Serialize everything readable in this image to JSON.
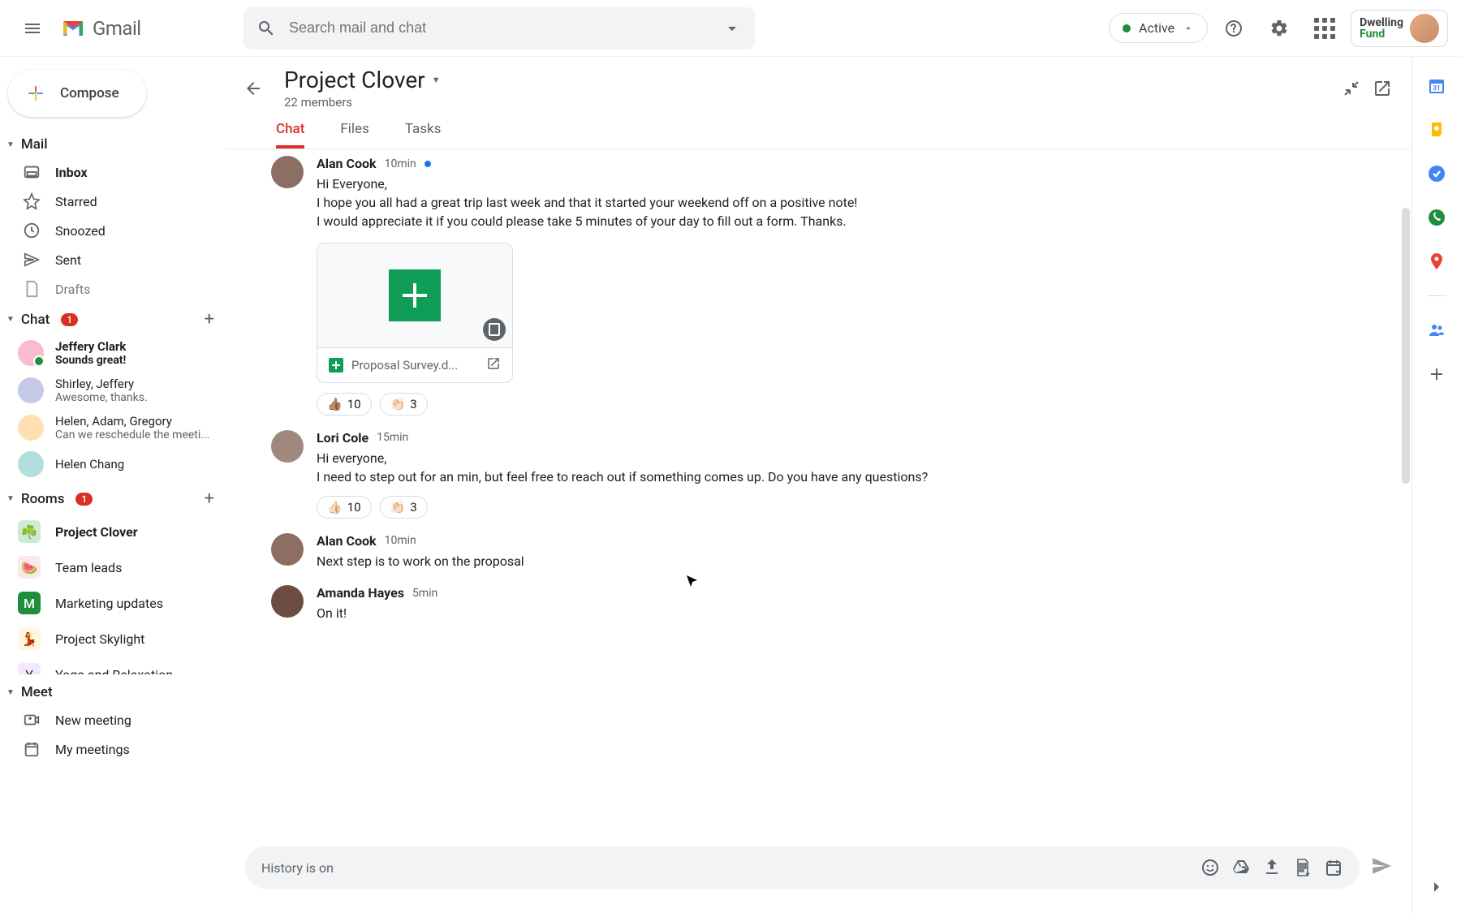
{
  "header": {
    "app_name": "Gmail",
    "search_placeholder": "Search mail and chat",
    "status_label": "Active",
    "brand_line1": "Dwelling",
    "brand_line2": "Fund"
  },
  "compose_label": "Compose",
  "sections": {
    "mail": {
      "title": "Mail"
    },
    "chat": {
      "title": "Chat",
      "badge": "1"
    },
    "rooms": {
      "title": "Rooms",
      "badge": "1"
    },
    "meet": {
      "title": "Meet"
    }
  },
  "mail_items": [
    {
      "label": "Inbox",
      "bold": true
    },
    {
      "label": "Starred"
    },
    {
      "label": "Snoozed"
    },
    {
      "label": "Sent"
    },
    {
      "label": "Drafts"
    }
  ],
  "chat_items": [
    {
      "name": "Jeffery Clark",
      "preview": "Sounds great!",
      "bold": true,
      "online": true,
      "color": "#f8bbd0"
    },
    {
      "name": "Shirley, Jeffery",
      "preview": "Awesome, thanks.",
      "color": "#c5cae9"
    },
    {
      "name": "Helen, Adam, Gregory",
      "preview": "Can we reschedule the meeti...",
      "color": "#ffe0b2"
    },
    {
      "name": "Helen Chang",
      "preview": "",
      "color": "#b2dfdb"
    }
  ],
  "room_items": [
    {
      "label": "Project Clover",
      "bold": true,
      "icon": "☘️",
      "color": "green"
    },
    {
      "label": "Team leads",
      "icon": "🍉",
      "color": "pink"
    },
    {
      "label": "Marketing updates",
      "icon": "M",
      "color": "mint"
    },
    {
      "label": "Project Skylight",
      "icon": "💃",
      "color": "yellow"
    },
    {
      "label": "Yoga and Relaxation",
      "icon": "Y",
      "color": "purple"
    }
  ],
  "meet_items": [
    {
      "label": "New meeting"
    },
    {
      "label": "My meetings"
    }
  ],
  "room": {
    "title": "Project Clover",
    "subtitle": "22 members",
    "tabs": [
      "Chat",
      "Files",
      "Tasks"
    ],
    "active_tab": 0
  },
  "messages": [
    {
      "name": "Alan Cook",
      "time": "10min",
      "new": true,
      "avatar_color": "#8d6e63",
      "lines": [
        "Hi Everyone,",
        "I hope you all had a great trip last week and that it started your weekend off on a positive note!",
        "I would appreciate it if you could please take 5 minutes of your day to fill out a form. Thanks."
      ],
      "attachment": {
        "name": "Proposal Survey.d..."
      },
      "reactions": [
        {
          "emoji": "👍🏽",
          "count": "10"
        },
        {
          "emoji": "👏🏻",
          "count": "3"
        }
      ]
    },
    {
      "name": "Lori Cole",
      "time": "15min",
      "avatar_color": "#a1887f",
      "lines": [
        "Hi everyone,",
        "I need to step out for an min, but feel free to reach out if something comes up.  Do you have any questions?"
      ],
      "reactions": [
        {
          "emoji": "👍🏻",
          "count": "10"
        },
        {
          "emoji": "👏🏻",
          "count": "3"
        }
      ]
    },
    {
      "name": "Alan Cook",
      "time": "10min",
      "avatar_color": "#8d6e63",
      "lines": [
        "Next step is to work on the proposal"
      ]
    },
    {
      "name": "Amanda Hayes",
      "time": "5min",
      "avatar_color": "#6d4c41",
      "lines": [
        "On it!"
      ]
    }
  ],
  "composer": {
    "placeholder": "History is on"
  }
}
